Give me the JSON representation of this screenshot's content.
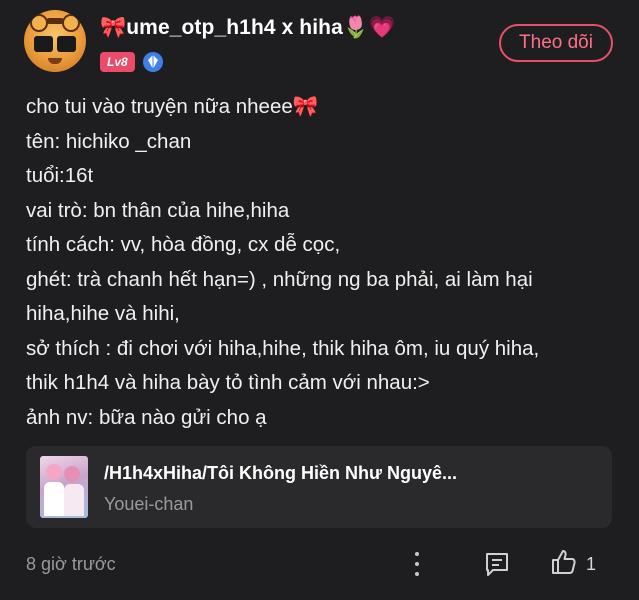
{
  "post": {
    "username": "🎀ume_otp_h1h4 x hiha🌷💗",
    "level": "Lv8",
    "follow_label": "Theo dõi",
    "lines": [
      "cho tui vào truyện nữa nheee🎀",
      "tên: hichiko _chan",
      "tuổi:16t",
      "vai trò: bn thân của hihe,hiha",
      "tính cách: vv, hòa đồng, cx dễ cọc,",
      "ghét: trà chanh hết hạn=) , những ng ba phải, ai làm hại",
      "hiha,hihe và hihi,",
      "sở thích : đi chơi với hiha,hihe, thik hiha ôm, iu quý hiha,",
      "thik h1h4 và hiha bày tỏ tình cảm với nhau:>",
      "ảnh nv: bữa nào gửi cho ạ"
    ],
    "story_card": {
      "title": "/H1h4xHiha/Tôi Không Hiền Như Nguyê...",
      "author": "Youei-chan"
    },
    "time": "8 giờ trước",
    "like_count": "1"
  },
  "icons": {
    "avatar": "tiger-avatar",
    "badge": "crystal-badge-icon",
    "more": "more-vertical-icon",
    "comment": "comment-icon",
    "like": "thumbs-up-icon"
  },
  "colors": {
    "background": "#1e1e20",
    "accent": "#e6506b",
    "level_badge": "#ec4c6b",
    "card": "#2a2a2d"
  }
}
